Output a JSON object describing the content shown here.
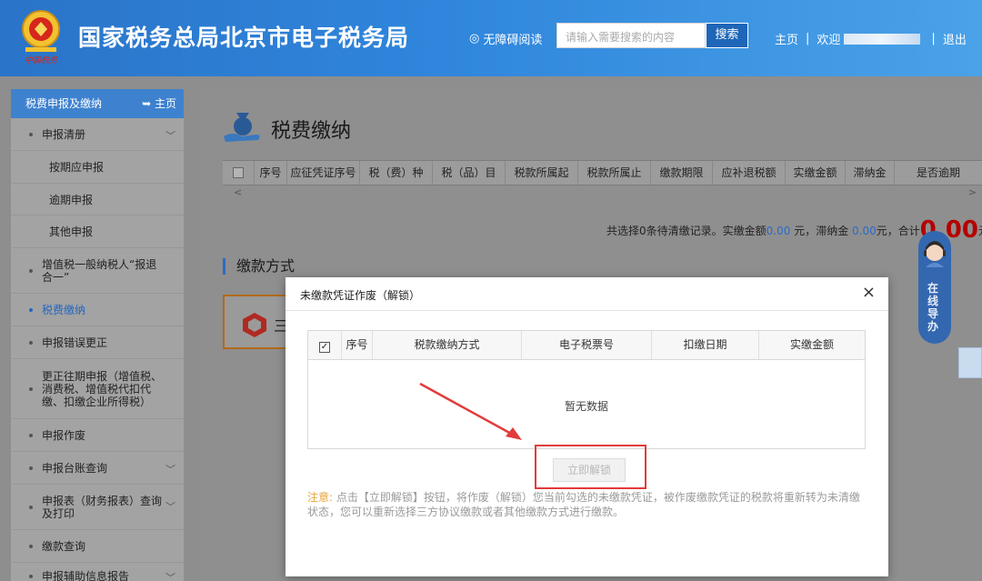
{
  "header": {
    "site_title": "国家税务总局北京市电子税务局",
    "accessibility_label": "无障碍阅读",
    "search_placeholder": "请输入需要搜索的内容",
    "search_button": "搜索",
    "home_link": "主页",
    "welcome_text": "欢迎",
    "logout_link": "退出",
    "emblem_caption": "中国税务"
  },
  "sidebar": {
    "section_title": "税费申报及缴纳",
    "home_link": "主页",
    "items": [
      {
        "label": "申报清册",
        "has_children": true
      },
      {
        "label": "按期应申报",
        "sub": true
      },
      {
        "label": "逾期申报",
        "sub": true
      },
      {
        "label": "其他申报",
        "sub": true
      },
      {
        "label": "增值税一般纳税人“报退合一”"
      },
      {
        "label": "税费缴纳",
        "active": true
      },
      {
        "label": "申报错误更正"
      },
      {
        "label": "更正往期申报（增值税、消费税、增值税代扣代缴、扣缴企业所得税）"
      },
      {
        "label": "申报作废"
      },
      {
        "label": "申报台账查询",
        "has_children": true
      },
      {
        "label": "申报表（财务报表）查询及打印",
        "has_children": true
      },
      {
        "label": "缴款查询"
      },
      {
        "label": "申报辅助信息报告",
        "has_children": true
      }
    ]
  },
  "main": {
    "title": "税费缴纳",
    "columns": [
      "序号",
      "应征凭证序号",
      "税（费）种",
      "税（品）目",
      "税款所属起",
      "税款所属止",
      "缴款期限",
      "应补退税额",
      "实缴金额",
      "滞纳金",
      "是否逾期"
    ],
    "summary": {
      "prefix": "共选择",
      "count": "0",
      "mid1": "条待清缴记录。实缴金额",
      "paid_amount": "0.00",
      "mid2": " 元，滞纳金 ",
      "late_fee": "0.00",
      "mid3": "元，合计",
      "total": "0.00",
      "suffix": "元。"
    },
    "payment_section_title": "缴款方式",
    "payment_card_label": "三"
  },
  "guide": {
    "label": "在线导办"
  },
  "modal": {
    "title": "未缴款凭证作废（解锁）",
    "close_symbol": "×",
    "columns": [
      "序号",
      "税款缴纳方式",
      "电子税票号",
      "扣缴日期",
      "实缴金额"
    ],
    "empty_text": "暂无数据",
    "unlock_button": "立即解锁",
    "note_label": "注意:",
    "note_text": "点击【立即解锁】按钮，将作废（解锁）您当前勾选的未缴款凭证，被作废缴款凭证的税款将重新转为未清缴状态，您可以重新选择三方协议缴款或者其他缴款方式进行缴款。"
  },
  "colors": {
    "header_blue": "#2f86dc",
    "highlight_red": "#e23b3b",
    "link_blue": "#2b6bc8",
    "total_red": "#b50000",
    "note_orange": "#e8a43a"
  }
}
